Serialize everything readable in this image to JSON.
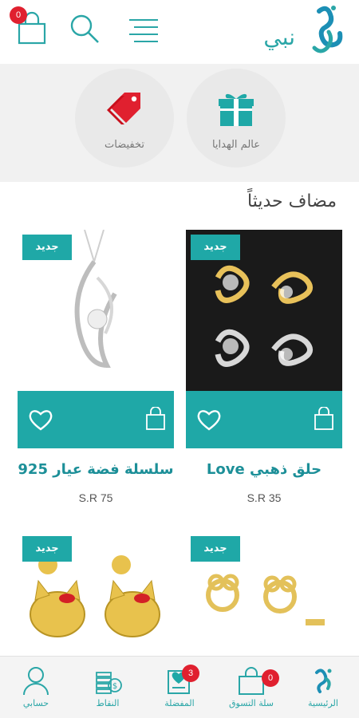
{
  "header": {
    "cart_count": "0",
    "logo_text": "نبي",
    "icons": [
      "cart-icon",
      "search-icon",
      "menu-icon",
      "logo"
    ]
  },
  "categories": [
    {
      "label": "تخفيضات",
      "icon": "price-tag-icon"
    },
    {
      "label": "عالم الهدايا",
      "icon": "gift-icon"
    }
  ],
  "section_title": "مضاف حديثاً",
  "products": [
    {
      "name": "Love حلق ذهبي",
      "price": "S.R 35",
      "badge": "جديد"
    },
    {
      "name": "سلسلة فضة عيار 925",
      "price": "S.R 75",
      "badge": "جديد"
    },
    {
      "name": "",
      "price": "",
      "badge": "جديد"
    },
    {
      "name": "",
      "price": "",
      "badge": "جديد"
    }
  ],
  "nav": {
    "home": "الرئيسية",
    "cart": "سلة التسوق",
    "cart_count": "0",
    "favorites": "المفضلة",
    "favorites_count": "3",
    "points": "النقاط",
    "account": "حسابي"
  },
  "colors": {
    "accent": "#1fa8a7",
    "badge": "#e0202f",
    "background": "#ffffff"
  }
}
